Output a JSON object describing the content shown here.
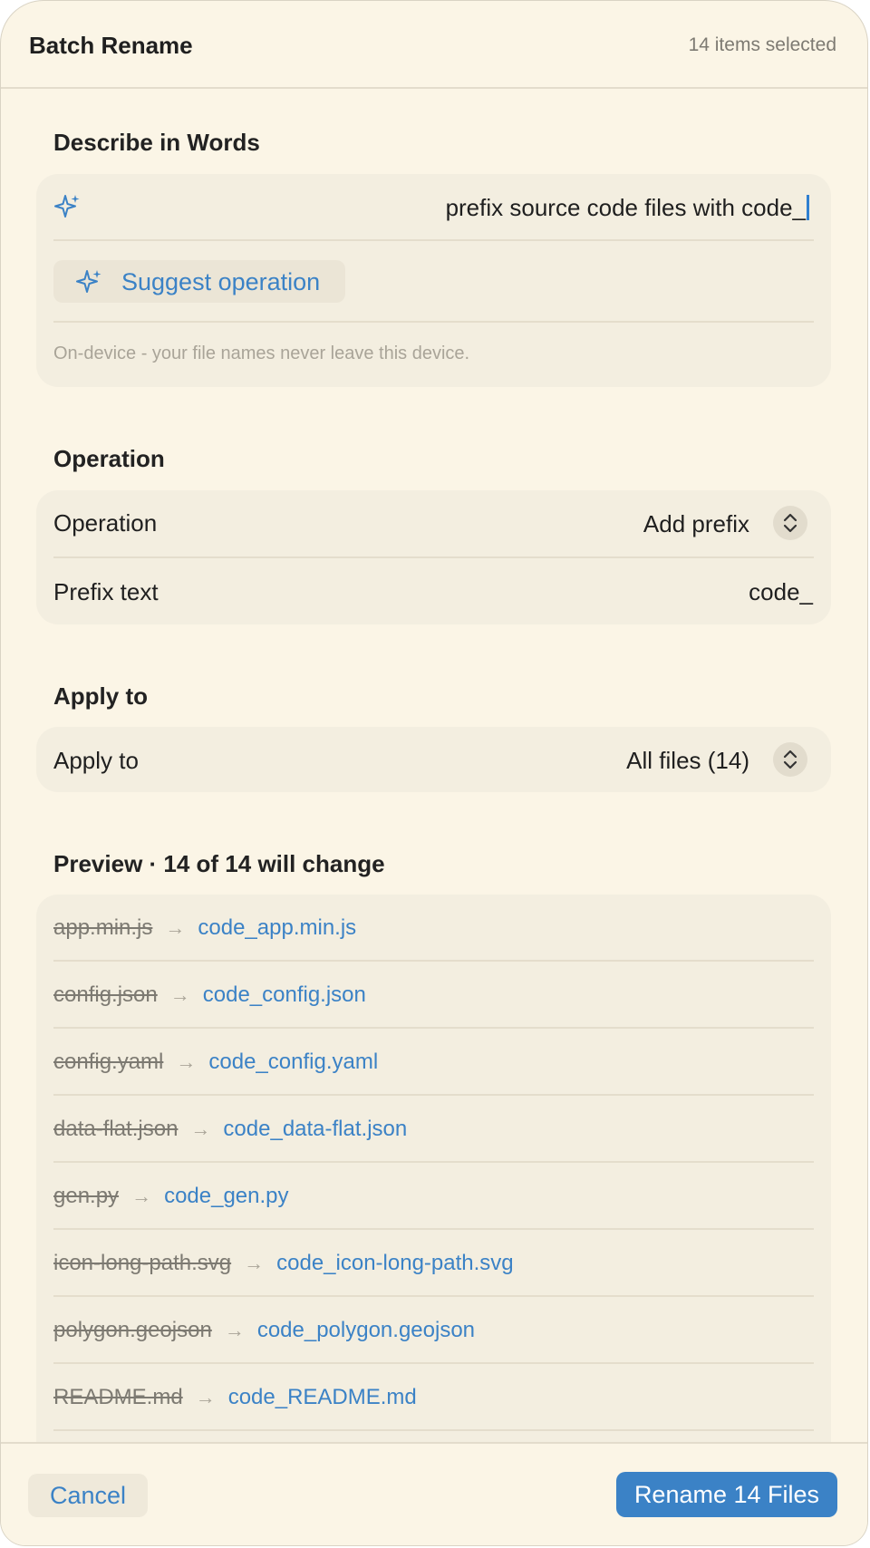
{
  "header": {
    "title": "Batch Rename",
    "selection_count": "14 items selected"
  },
  "describe": {
    "section_label": "Describe in Words",
    "prompt_value": "prefix source code files with code_",
    "suggest_label": "Suggest operation",
    "privacy_note": "On-device - your file names never leave this device."
  },
  "operation": {
    "section_label": "Operation",
    "operation_label": "Operation",
    "operation_value": "Add prefix",
    "prefix_label": "Prefix text",
    "prefix_value": "code_"
  },
  "apply": {
    "section_label": "Apply to",
    "label": "Apply to",
    "value": "All files (14)"
  },
  "preview": {
    "section_label": "Preview · 14 of 14 will change",
    "arrow": "→",
    "rows": [
      {
        "old": "app.min.js",
        "new": "code_app.min.js"
      },
      {
        "old": "config.json",
        "new": "code_config.json"
      },
      {
        "old": "config.yaml",
        "new": "code_config.yaml"
      },
      {
        "old": "data-flat.json",
        "new": "code_data-flat.json"
      },
      {
        "old": "gen.py",
        "new": "code_gen.py"
      },
      {
        "old": "icon-long-path.svg",
        "new": "code_icon-long-path.svg"
      },
      {
        "old": "polygon.geojson",
        "new": "code_polygon.geojson"
      },
      {
        "old": "README.md",
        "new": "code_README.md"
      }
    ]
  },
  "footer": {
    "cancel_label": "Cancel",
    "rename_label": "Rename 14 Files"
  },
  "colors": {
    "accent": "#3b82c6",
    "background": "#fbf5e6",
    "card": "#f3eee0"
  },
  "icons": {
    "sparkle": "sparkle-icon",
    "stepper": "chevron-up-down-icon",
    "arrow": "arrow-right-icon"
  }
}
